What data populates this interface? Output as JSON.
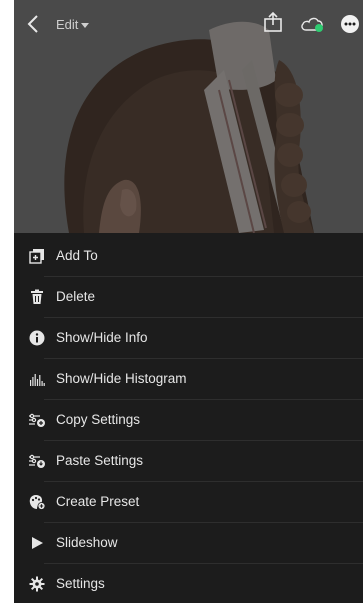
{
  "header": {
    "edit_label": "Edit"
  },
  "menu": {
    "items": [
      {
        "label": "Add To",
        "icon": "add-to-icon"
      },
      {
        "label": "Delete",
        "icon": "trash-icon"
      },
      {
        "label": "Show/Hide Info",
        "icon": "info-icon"
      },
      {
        "label": "Show/Hide Histogram",
        "icon": "histogram-icon"
      },
      {
        "label": "Copy Settings",
        "icon": "copy-settings-icon"
      },
      {
        "label": "Paste Settings",
        "icon": "paste-settings-icon"
      },
      {
        "label": "Create Preset",
        "icon": "create-preset-icon"
      },
      {
        "label": "Slideshow",
        "icon": "play-icon"
      },
      {
        "label": "Settings",
        "icon": "gear-icon"
      }
    ]
  },
  "colors": {
    "menu_bg": "#1c1c1c",
    "text": "#e6e6e6",
    "cloud_status": "#2ecc71"
  }
}
